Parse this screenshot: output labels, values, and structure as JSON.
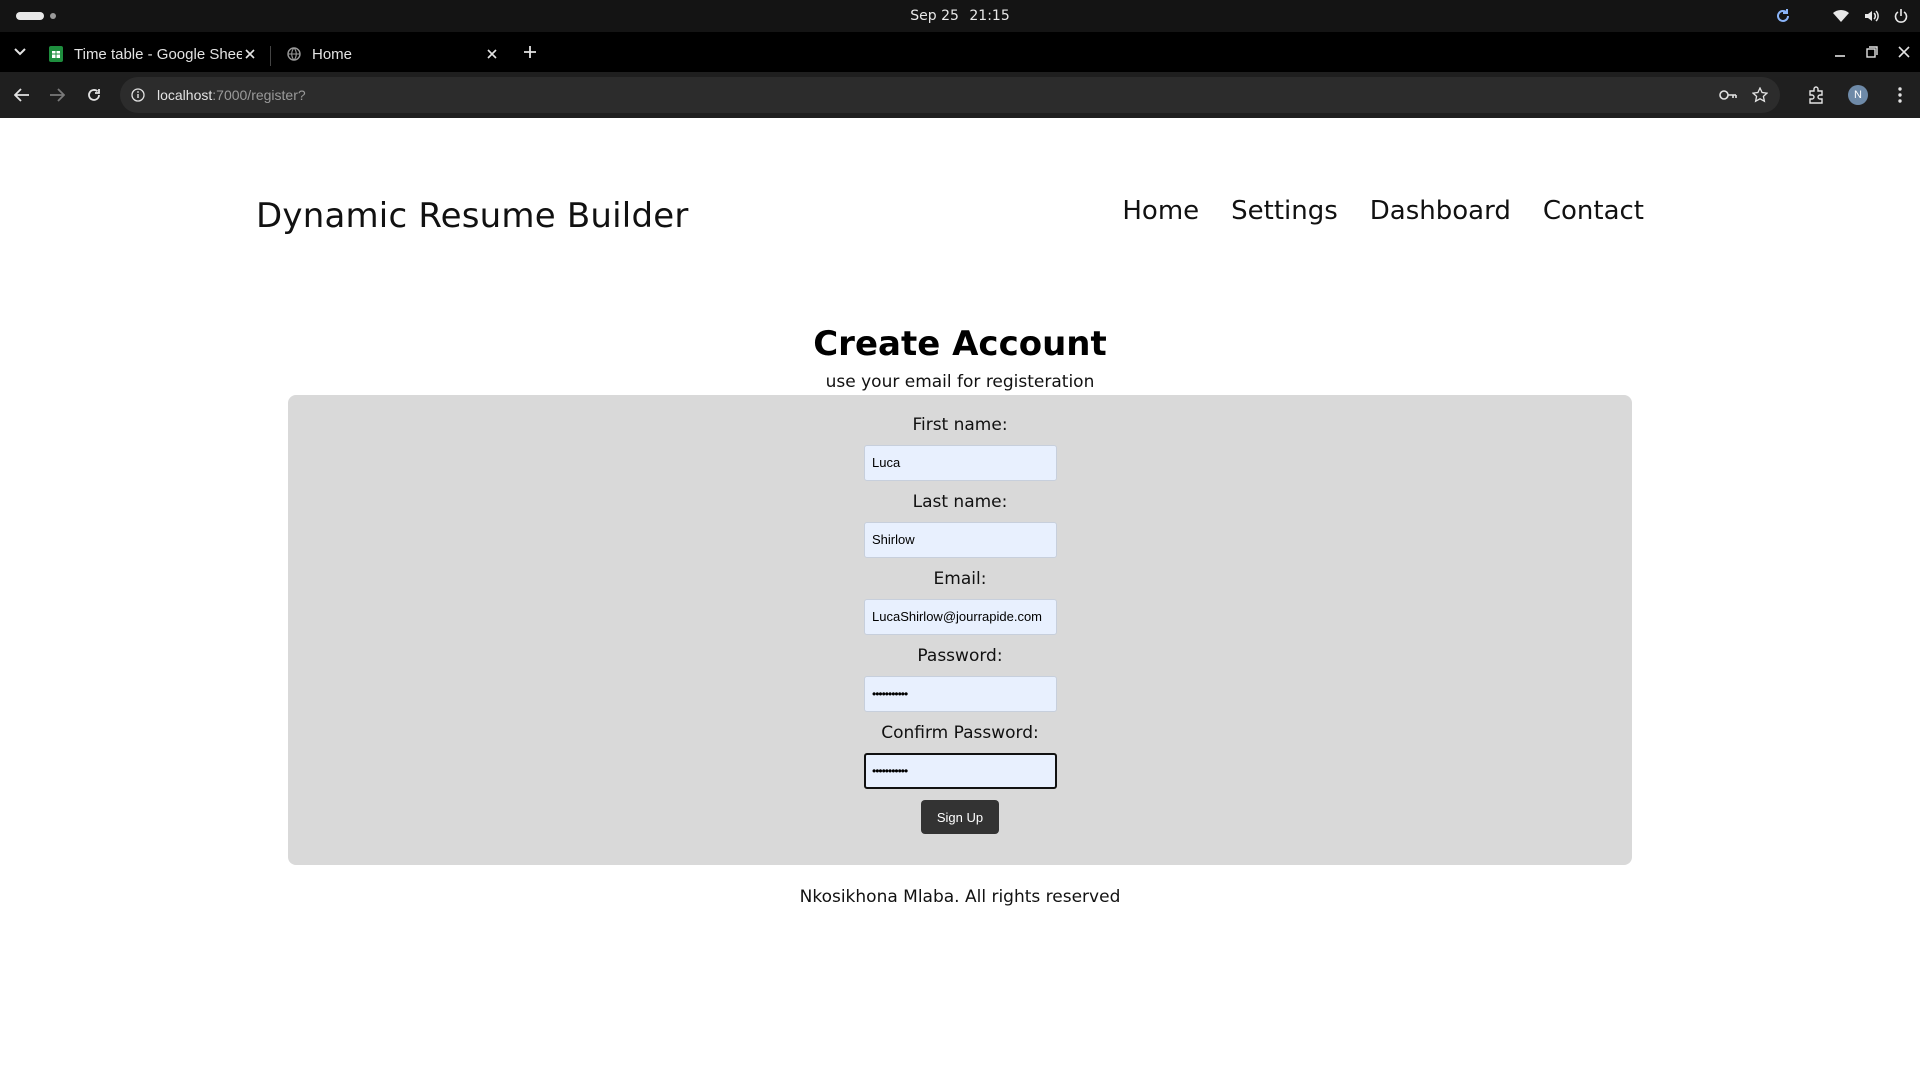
{
  "os": {
    "date": "Sep 25",
    "time": "21:15"
  },
  "browser": {
    "tabs": [
      {
        "title": "Time table - Google Sheets",
        "favicon": "google-sheets-icon",
        "active": false
      },
      {
        "title": "Home",
        "favicon": "globe-icon",
        "active": true
      }
    ],
    "url": {
      "host": "localhost",
      "path": ":7000/register?"
    },
    "profile_initial": "N"
  },
  "site": {
    "title": "Dynamic Resume Builder",
    "nav": [
      "Home",
      "Settings",
      "Dashboard",
      "Contact"
    ]
  },
  "form": {
    "title": "Create Account",
    "subtitle": "use your email for registeration",
    "fields": {
      "first_name": {
        "label": "First name:",
        "value": "Luca"
      },
      "last_name": {
        "label": "Last name:",
        "value": "Shirlow"
      },
      "email": {
        "label": "Email:",
        "value": "LucaShirlow@jourrapide.com"
      },
      "password": {
        "label": "Password:",
        "value": "•••••••••••"
      },
      "confirm_password": {
        "label": "Confirm Password:",
        "value": "•••••••••••"
      }
    },
    "submit_label": "Sign Up"
  },
  "footer": {
    "text": "Nkosikhona Mlaba. All rights reserved"
  },
  "colors": {
    "panel_bg": "#d9d9d9",
    "autofill_bg": "#e8f0fe",
    "button_bg": "#333333",
    "browser_toolbar": "#1f1f1f"
  }
}
